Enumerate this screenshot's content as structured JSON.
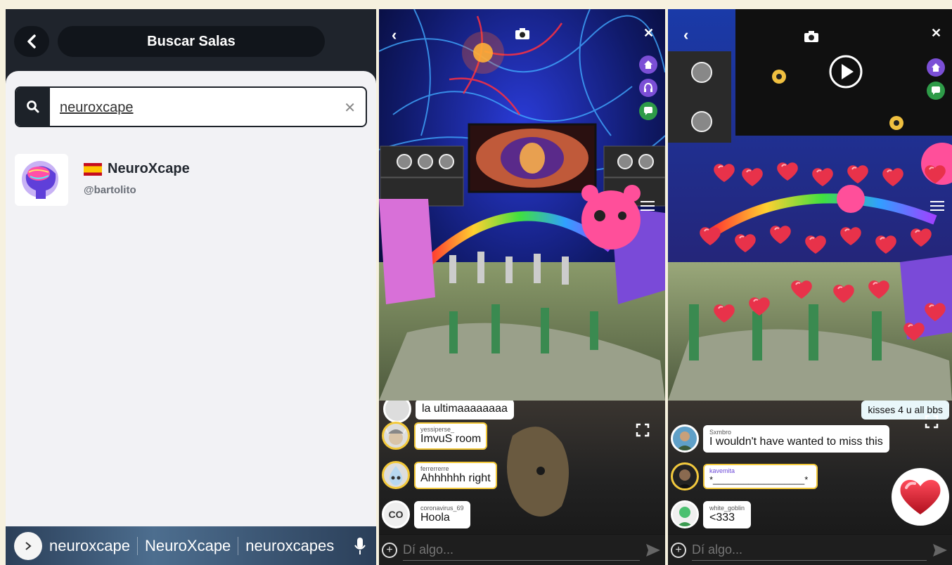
{
  "search_screen": {
    "title": "Buscar Salas",
    "query": "neuroxcape",
    "results": [
      {
        "name": "NeuroXcape",
        "handle": "@bartolito",
        "flag": "spain-flag"
      }
    ],
    "keyboard_suggestions": [
      "neuroxcape",
      "NeuroXcape",
      "neuroxcapes"
    ]
  },
  "room_left": {
    "partial_message": "la ultimaaaaaaaa",
    "messages": [
      {
        "user": "yessiperse_",
        "text": "ImvuS room",
        "avatar": "viking-avatar"
      },
      {
        "user": "ferrerrerre",
        "text": "Ahhhhhh right",
        "avatar": "drop-avatar"
      },
      {
        "user": "coronavirus_69",
        "text": "Hoola",
        "avatar_initials": "CO"
      }
    ],
    "input_placeholder": "Dí algo..."
  },
  "room_right": {
    "partial_message": "kisses 4 u all bbs",
    "messages": [
      {
        "user": "Sxmbro",
        "text": "I wouldn't have wanted to miss this",
        "avatar": "man-avatar"
      },
      {
        "user": "kavemita",
        "text": "*__________________*",
        "avatar": "dark-avatar"
      },
      {
        "user": "white_goblin",
        "text": "<333",
        "avatar": "goblin-avatar"
      }
    ],
    "input_placeholder": "Dí algo..."
  },
  "colors": {
    "dark": "#1f242c",
    "highlight": "#f3c93b",
    "side_purple": "#7b4fd6",
    "side_green": "#2e9b48"
  }
}
